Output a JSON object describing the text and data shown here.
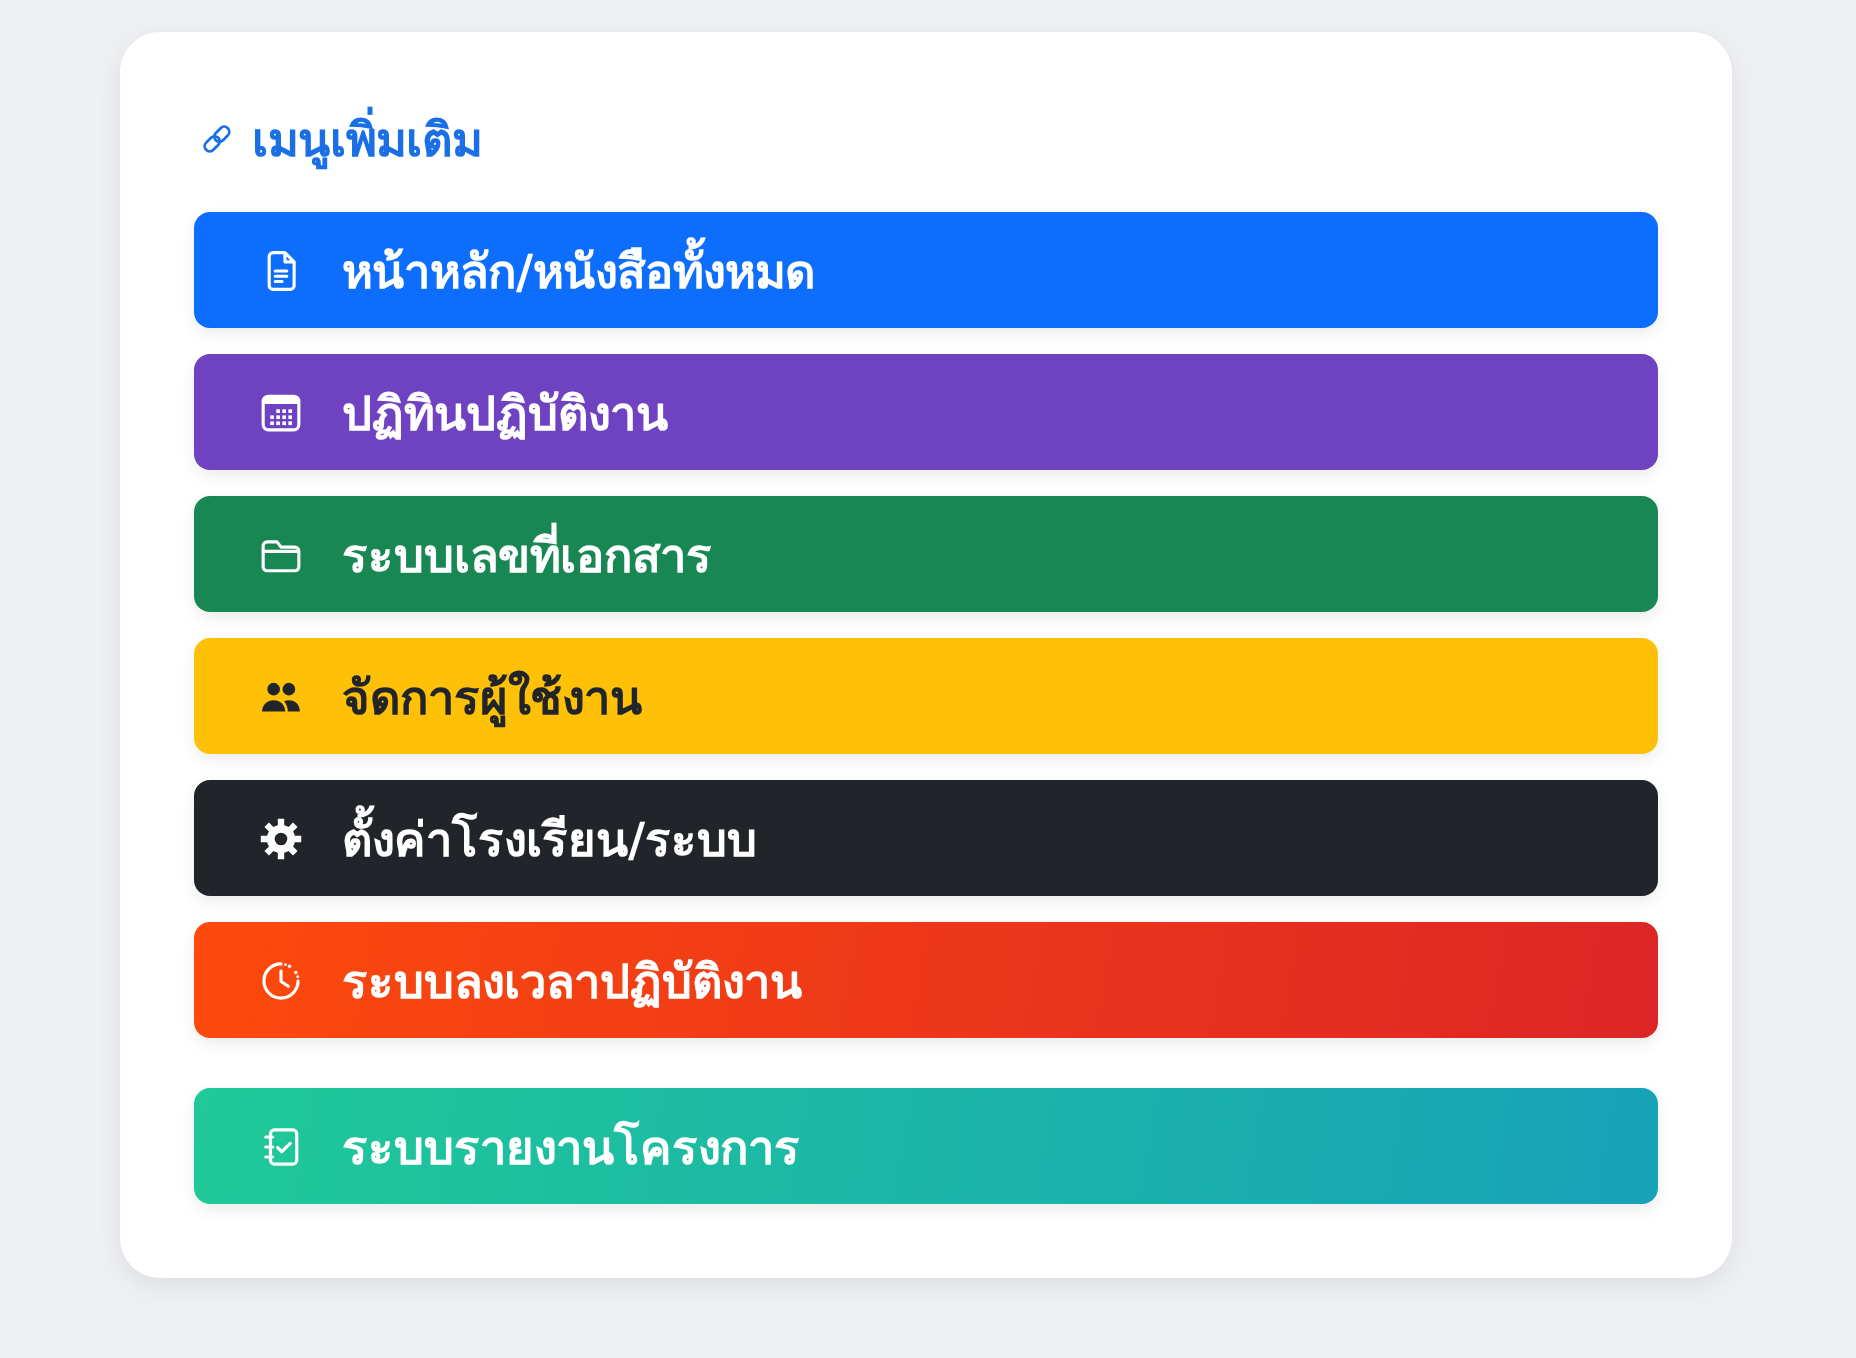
{
  "header": {
    "title": "เมนูเพิ่มเติม"
  },
  "menu": [
    {
      "label": "หน้าหลัก/หนังสือทั้งหมด",
      "color": "#0d6efd"
    },
    {
      "label": "ปฏิทินปฏิบัติงาน",
      "color": "#6f42c1"
    },
    {
      "label": "ระบบเลขที่เอกสาร",
      "color": "#198754"
    },
    {
      "label": "จัดการผู้ใช้งาน",
      "color": "#ffc107"
    },
    {
      "label": "ตั้งค่าโรงเรียน/ระบบ",
      "color": "#212529"
    },
    {
      "label": "ระบบลงเวลาปฏิบัติงาน",
      "color": "#fc4a0c",
      "gradient": {
        "color": "#dc2626"
      }
    },
    {
      "label": "ระบบรายงานโครงการ",
      "color": "#20c997",
      "gradient": {
        "color": "#17a2b8"
      }
    }
  ]
}
